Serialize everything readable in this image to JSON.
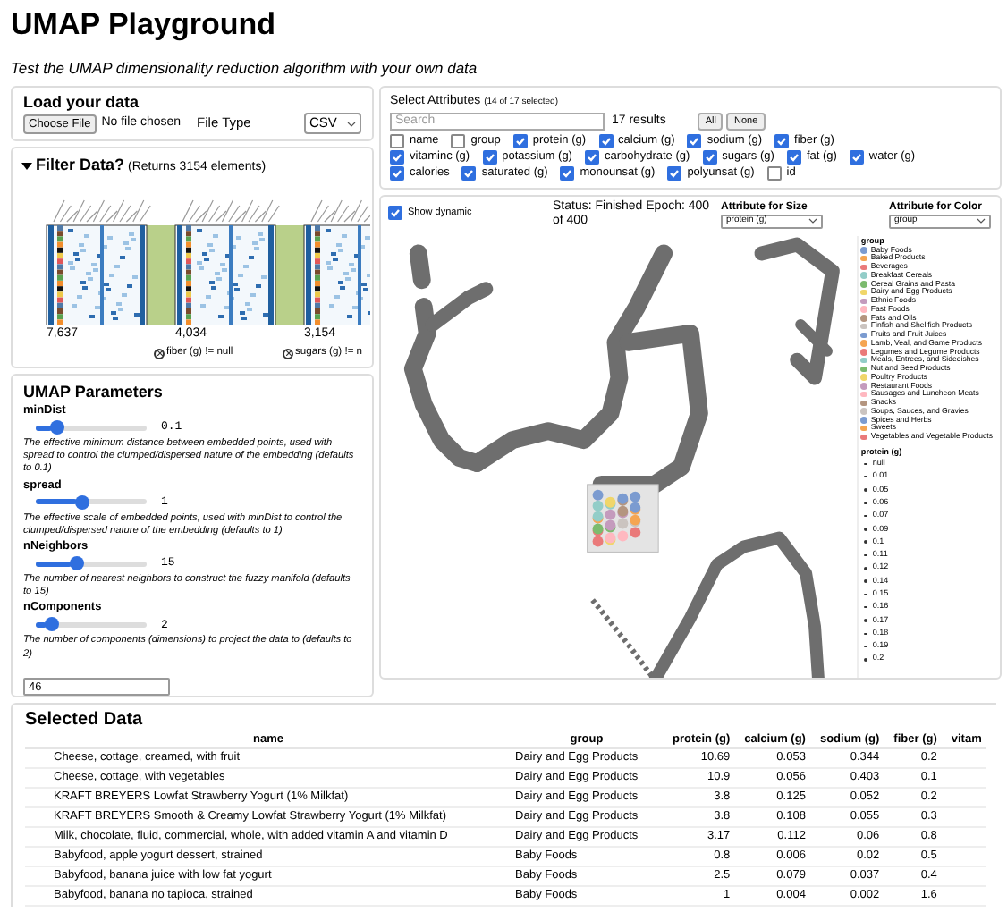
{
  "title": "UMAP Playground",
  "subtitle": "Test the UMAP dimensionality reduction algorithm with your own data",
  "load": {
    "title": "Load your data",
    "file_button": "Choose File",
    "file_status": "No file chosen",
    "file_type_label": "File Type",
    "file_type": "CSV"
  },
  "filter": {
    "title": "Filter Data?",
    "summary": "(Returns 3154 elements)",
    "expanded": true,
    "steps": [
      {
        "count": "7,637"
      },
      {
        "count": "4,034",
        "filter": "fiber (g) != null"
      },
      {
        "count": "3,154",
        "filter": "sugars (g) != n"
      }
    ]
  },
  "params": {
    "title": "UMAP Parameters",
    "seed": "46",
    "items": [
      {
        "name": "minDist",
        "value": "0.1",
        "level": 0.15,
        "help": "The effective minimum distance between embedded points, used with spread to control the clumped/dispersed nature of the embedding (defaults to 0.1)"
      },
      {
        "name": "spread",
        "value": "1",
        "level": 0.37,
        "help": "The effective scale of embedded points, used with minDist to control the clumped/dispersed nature of the embedding (defaults to 1)"
      },
      {
        "name": "nNeighbors",
        "value": "15",
        "level": 0.32,
        "help": "The number of nearest neighbors to construct the fuzzy manifold (defaults to 15)"
      },
      {
        "name": "nComponents",
        "value": "2",
        "level": 0.1,
        "help": "The number of components (dimensions) to project the data to (defaults to 2)"
      }
    ]
  },
  "attributes": {
    "title": "Select Attributes",
    "summary": "(14 of 17 selected)",
    "search_placeholder": "Search",
    "results": "17 results",
    "buttons": [
      "All",
      "None"
    ],
    "items": [
      {
        "label": "name",
        "checked": false
      },
      {
        "label": "group",
        "checked": false
      },
      {
        "label": "protein (g)",
        "checked": true
      },
      {
        "label": "calcium (g)",
        "checked": true
      },
      {
        "label": "sodium (g)",
        "checked": true
      },
      {
        "label": "fiber (g)",
        "checked": true
      },
      {
        "label": "vitaminc (g)",
        "checked": true
      },
      {
        "label": "potassium (g)",
        "checked": true
      },
      {
        "label": "carbohydrate (g)",
        "checked": true
      },
      {
        "label": "sugars (g)",
        "checked": true
      },
      {
        "label": "fat (g)",
        "checked": true
      },
      {
        "label": "water (g)",
        "checked": true
      },
      {
        "label": "calories",
        "checked": true
      },
      {
        "label": "saturated (g)",
        "checked": true
      },
      {
        "label": "monounsat (g)",
        "checked": true
      },
      {
        "label": "polyunsat (g)",
        "checked": true
      },
      {
        "label": "id",
        "checked": false
      }
    ]
  },
  "plot": {
    "show_dynamic": {
      "label": "Show dynamic",
      "checked": true
    },
    "status": "Status: Finished Epoch: 400 of 400",
    "size_label": "Attribute for Size",
    "size_value": "protein (g)",
    "color_label": "Attribute for Color",
    "color_value": "group",
    "legend_color_title": "group",
    "groups": [
      {
        "label": "Baby Foods",
        "color": "#7b9bd0"
      },
      {
        "label": "Baked Products",
        "color": "#f5a552"
      },
      {
        "label": "Beverages",
        "color": "#ea7a7a"
      },
      {
        "label": "Breakfast Cereals",
        "color": "#93cdc8"
      },
      {
        "label": "Cereal Grains and Pasta",
        "color": "#7cbb6e"
      },
      {
        "label": "Dairy and Egg Products",
        "color": "#f0d66a"
      },
      {
        "label": "Ethnic Foods",
        "color": "#c49bbd"
      },
      {
        "label": "Fast Foods",
        "color": "#ffb8c0"
      },
      {
        "label": "Fats and Oils",
        "color": "#b4957f"
      },
      {
        "label": "Finfish and Shellfish Products",
        "color": "#cbc4c0"
      },
      {
        "label": "Fruits and Fruit Juices",
        "color": "#7b9bd0"
      },
      {
        "label": "Lamb, Veal, and Game Products",
        "color": "#f5a552"
      },
      {
        "label": "Legumes and Legume Products",
        "color": "#ea7a7a"
      },
      {
        "label": "Meals, Entrees, and Sidedishes",
        "color": "#93cdc8"
      },
      {
        "label": "Nut and Seed Products",
        "color": "#7cbb6e"
      },
      {
        "label": "Poultry Products",
        "color": "#f0d66a"
      },
      {
        "label": "Restaurant Foods",
        "color": "#c49bbd"
      },
      {
        "label": "Sausages and Luncheon Meats",
        "color": "#ffb8c0"
      },
      {
        "label": "Snacks",
        "color": "#b4957f"
      },
      {
        "label": "Soups, Sauces, and Gravies",
        "color": "#cbc4c0"
      },
      {
        "label": "Spices and Herbs",
        "color": "#7b9bd0"
      },
      {
        "label": "Sweets",
        "color": "#f5a552"
      },
      {
        "label": "Vegetables and Vegetable Products",
        "color": "#ea7a7a"
      }
    ],
    "legend_size_title": "protein (g)",
    "sizes": [
      "null",
      "0.01",
      "0.05",
      "0.06",
      "0.07",
      "0.09",
      "0.1",
      "0.11",
      "0.12",
      "0.14",
      "0.15",
      "0.16",
      "0.17",
      "0.18",
      "0.19",
      "0.2"
    ]
  },
  "table": {
    "title": "Selected Data",
    "columns": [
      "name",
      "group",
      "protein (g)",
      "calcium (g)",
      "sodium (g)",
      "fiber (g)",
      "vitam"
    ],
    "rows": [
      [
        "Cheese, cottage, creamed, with fruit",
        "Dairy and Egg Products",
        "10.69",
        "0.053",
        "0.344",
        "0.2"
      ],
      [
        "Cheese, cottage, with vegetables",
        "Dairy and Egg Products",
        "10.9",
        "0.056",
        "0.403",
        "0.1"
      ],
      [
        "KRAFT BREYERS Lowfat Strawberry Yogurt (1% Milkfat)",
        "Dairy and Egg Products",
        "3.8",
        "0.125",
        "0.052",
        "0.2"
      ],
      [
        "KRAFT BREYERS Smooth & Creamy Lowfat Strawberry Yogurt (1% Milkfat)",
        "Dairy and Egg Products",
        "3.8",
        "0.108",
        "0.055",
        "0.3"
      ],
      [
        "Milk, chocolate, fluid, commercial, whole, with added vitamin A and vitamin D",
        "Dairy and Egg Products",
        "3.17",
        "0.112",
        "0.06",
        "0.8"
      ],
      [
        "Babyfood, apple yogurt dessert, strained",
        "Baby Foods",
        "0.8",
        "0.006",
        "0.02",
        "0.5"
      ],
      [
        "Babyfood, banana juice with low fat yogurt",
        "Baby Foods",
        "2.5",
        "0.079",
        "0.037",
        "0.4"
      ],
      [
        "Babyfood, banana no tapioca, strained",
        "Baby Foods",
        "1",
        "0.004",
        "0.002",
        "1.6"
      ]
    ]
  }
}
